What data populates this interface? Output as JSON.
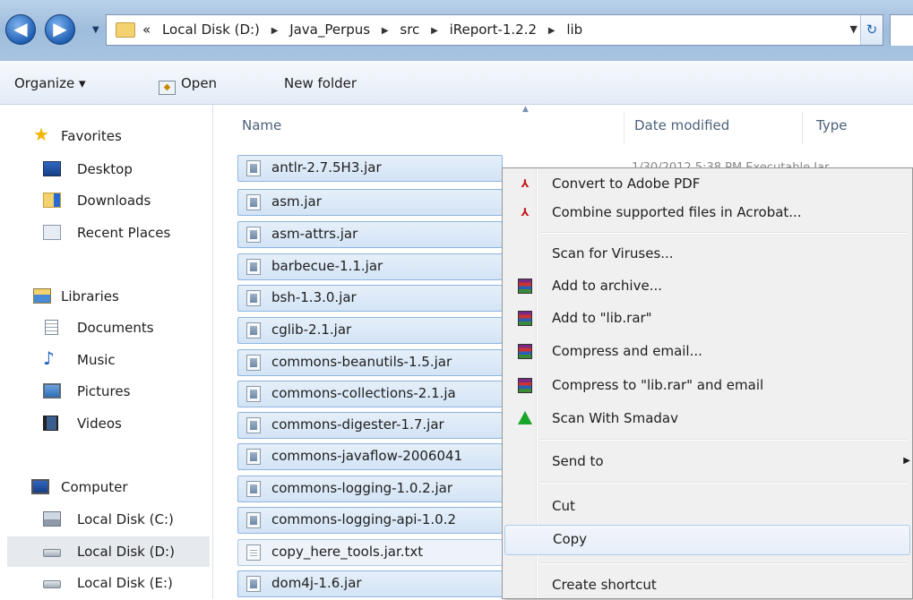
{
  "address": {
    "overflow": "«",
    "crumbs": [
      "Local Disk (D:)",
      "Java_Perpus",
      "src",
      "iReport-1.2.2",
      "lib"
    ],
    "separator": "▶"
  },
  "toolbar": {
    "organize_label": "Organize ▾",
    "open_label": "Open",
    "new_folder_label": "New folder"
  },
  "nav": {
    "favorites": "Favorites",
    "desktop": "Desktop",
    "downloads": "Downloads",
    "recent": "Recent Places",
    "libraries": "Libraries",
    "documents": "Documents",
    "music": "Music",
    "pictures": "Pictures",
    "videos": "Videos",
    "computer": "Computer",
    "disk_c": "Local Disk (C:)",
    "disk_d": "Local Disk (D:)",
    "disk_e": "Local Disk (E:)"
  },
  "columns": {
    "name": "Name",
    "date": "Date modified",
    "type": "Type"
  },
  "first_row_partial": "1/30/2012 5:38 PM     Executable Jar",
  "files": [
    "antlr-2.7.5H3.jar",
    "asm.jar",
    "asm-attrs.jar",
    "barbecue-1.1.jar",
    "bsh-1.3.0.jar",
    "cglib-2.1.jar",
    "commons-beanutils-1.5.jar",
    "commons-collections-2.1.ja",
    "commons-digester-1.7.jar",
    "commons-javaflow-2006041",
    "commons-logging-1.0.2.jar",
    "commons-logging-api-1.0.2",
    "copy_here_tools.jar.txt",
    "dom4j-1.6.jar"
  ],
  "context_menu": {
    "convert_pdf": "Convert to Adobe PDF",
    "combine_acrobat": "Combine supported files in Acrobat...",
    "scan_viruses": "Scan for Viruses...",
    "add_archive": "Add to archive...",
    "add_lib_rar": "Add to \"lib.rar\"",
    "compress_email": "Compress and email...",
    "compress_lib_email": "Compress to \"lib.rar\" and email",
    "scan_smadav": "Scan With Smadav",
    "send_to": "Send to",
    "cut": "Cut",
    "copy": "Copy",
    "create_shortcut": "Create shortcut"
  }
}
